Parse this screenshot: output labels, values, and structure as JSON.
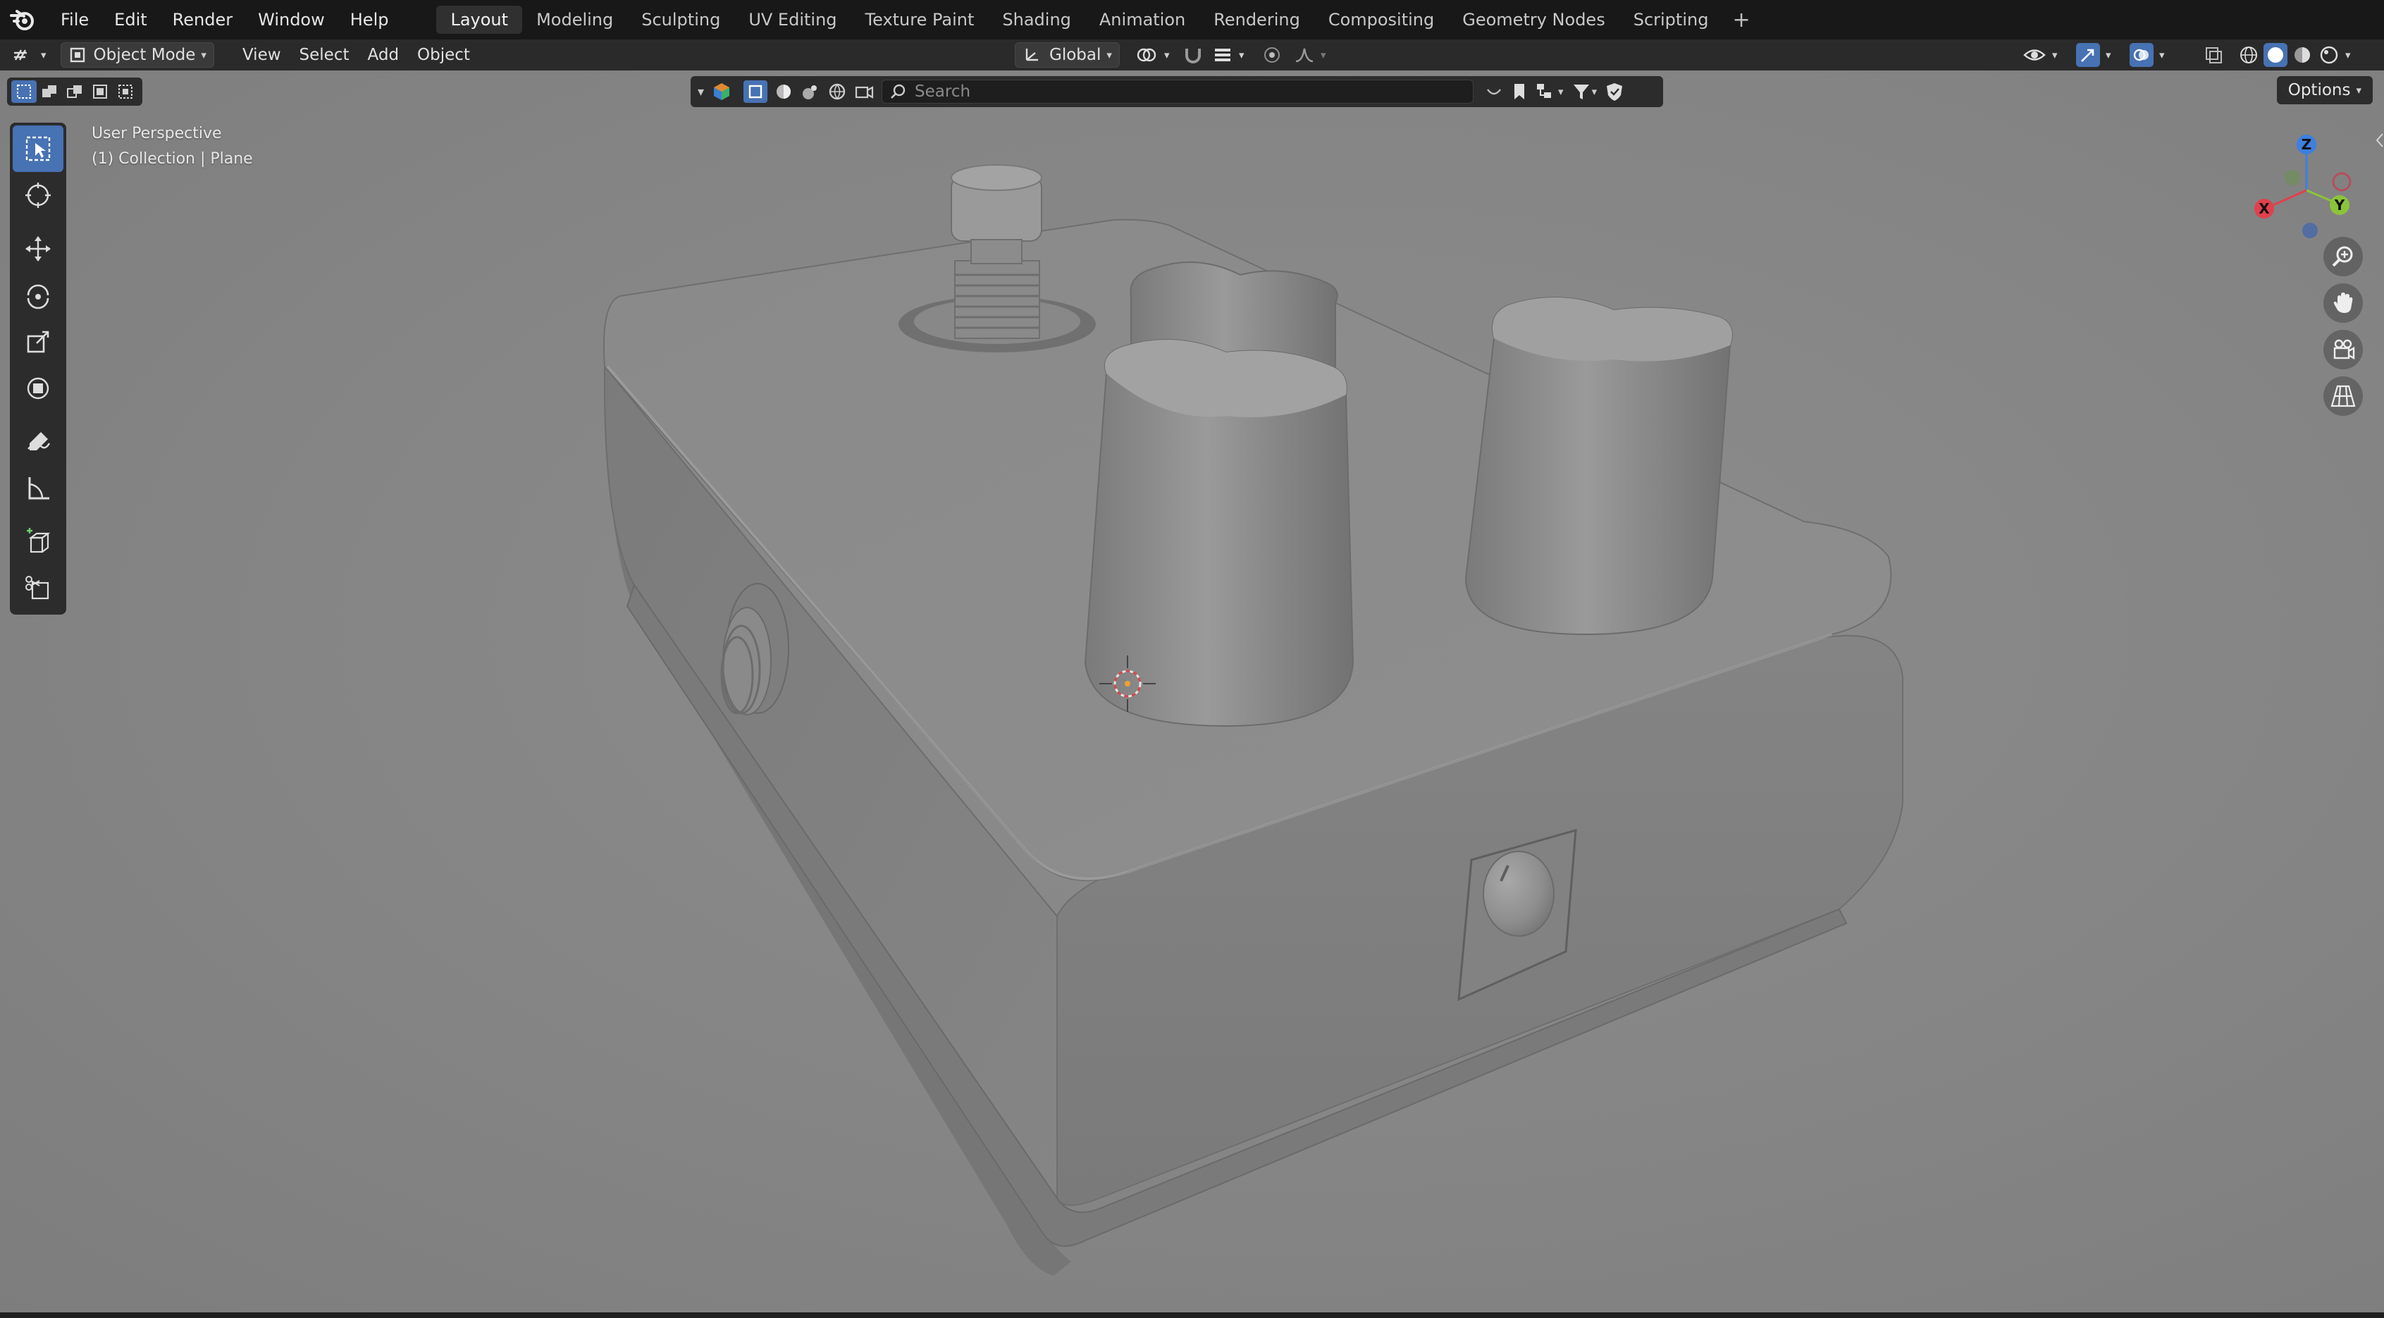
{
  "menu": [
    "File",
    "Edit",
    "Render",
    "Window",
    "Help"
  ],
  "workspace_tabs": [
    "Layout",
    "Modeling",
    "Sculpting",
    "UV Editing",
    "Texture Paint",
    "Shading",
    "Animation",
    "Rendering",
    "Compositing",
    "Geometry Nodes",
    "Scripting"
  ],
  "active_tab": "Layout",
  "add_tab_symbol": "+",
  "header": {
    "mode": "Object Mode",
    "view_menus": [
      "View",
      "Select",
      "Add",
      "Object"
    ],
    "transform_orientation": "Global"
  },
  "outliner_search": {
    "placeholder": "Search"
  },
  "options_label": "Options",
  "viewport_info": {
    "line1": "User Perspective",
    "line2": "(1) Collection | Plane"
  },
  "gizmo_axes": {
    "z": "Z",
    "y": "Y",
    "x": "X"
  },
  "colors": {
    "accent": "#4772b3",
    "axis_x": "#e0414d",
    "axis_y": "#8bc43a",
    "axis_z": "#3e7fe0"
  },
  "icons": [
    "blender-logo-icon",
    "select-box-icon",
    "cursor-icon",
    "move-icon",
    "rotate-icon",
    "scale-icon",
    "transform-icon",
    "annotate-icon",
    "measure-icon",
    "add-cube-icon",
    "cut-icon",
    "zoom-icon",
    "pan-hand-icon",
    "camera-icon",
    "grid-icon"
  ]
}
